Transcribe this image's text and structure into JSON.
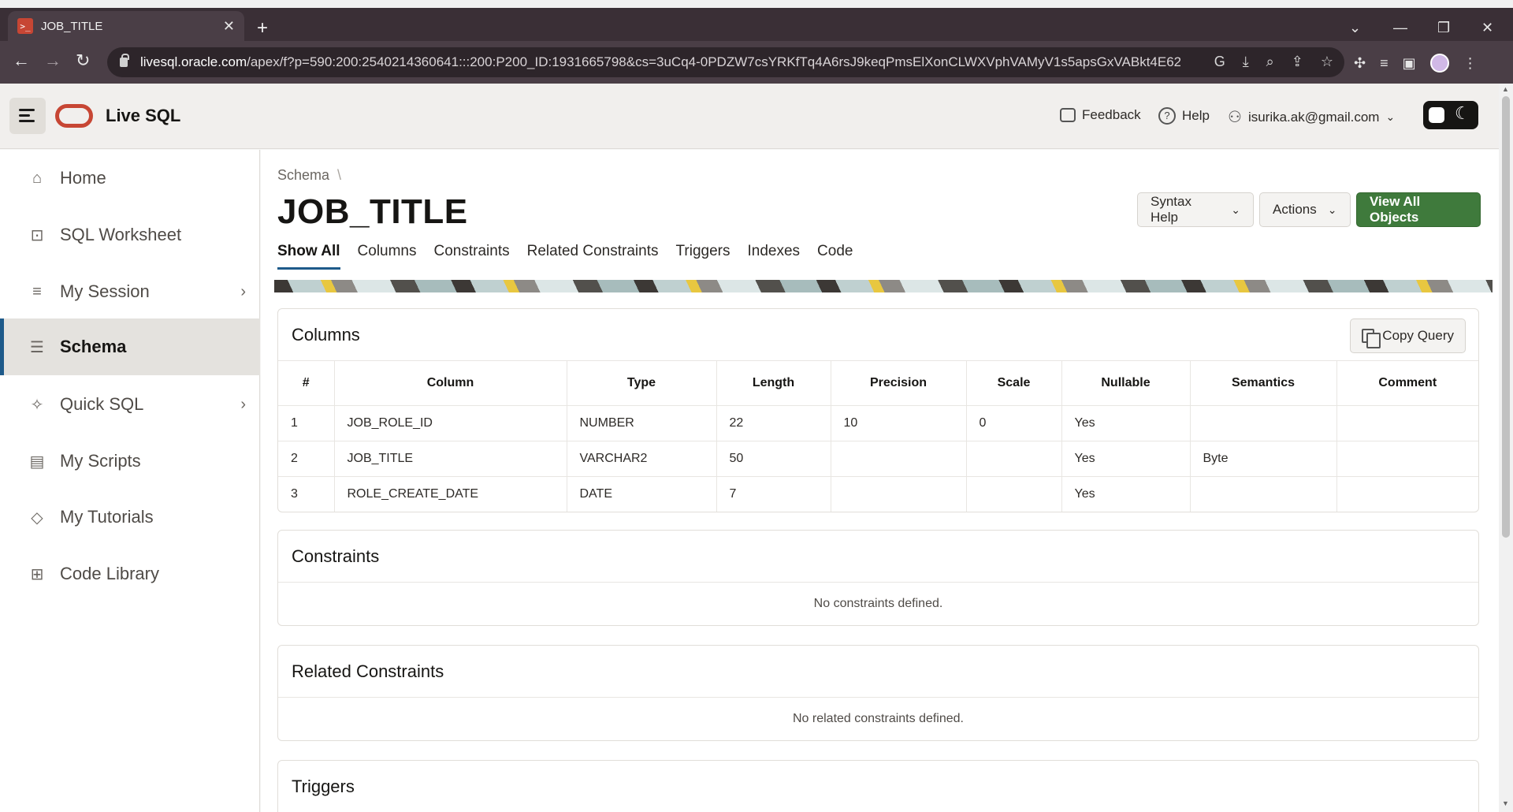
{
  "browser": {
    "tab_title": "JOB_TITLE",
    "tab_favicon": ">_",
    "url_host": "livesql.oracle.com",
    "url_path": "/apex/f?p=590:200:2540214360641:::200:P200_ID:1931665798&cs=3uCq4-0PDZW7csYRKfTq4A6rsJ9keqPmsElXonCLWXVphVAMyV1s5apsGxVABkt4E62W..."
  },
  "header": {
    "app_title": "Live SQL",
    "feedback": "Feedback",
    "help": "Help",
    "user": "isurika.ak@gmail.com"
  },
  "sidebar": {
    "items": [
      {
        "label": "Home",
        "icon": "home-icon",
        "active": false
      },
      {
        "label": "SQL Worksheet",
        "icon": "terminal-icon",
        "active": false
      },
      {
        "label": "My Session",
        "icon": "list-icon",
        "active": false
      },
      {
        "label": "Schema",
        "icon": "database-icon",
        "active": true
      },
      {
        "label": "Quick SQL",
        "icon": "wand-icon",
        "active": false
      },
      {
        "label": "My Scripts",
        "icon": "document-icon",
        "active": false
      },
      {
        "label": "My Tutorials",
        "icon": "graduation-cap-icon",
        "active": false
      },
      {
        "label": "Code Library",
        "icon": "library-icon",
        "active": false
      }
    ]
  },
  "main": {
    "breadcrumb": "Schema",
    "title": "JOB_TITLE",
    "buttons": {
      "syntax_help": "Syntax Help",
      "actions": "Actions",
      "view_all": "View All Objects"
    },
    "tabs": [
      "Show All",
      "Columns",
      "Constraints",
      "Related Constraints",
      "Triggers",
      "Indexes",
      "Code"
    ],
    "active_tab": "Show All",
    "columns_section": {
      "title": "Columns",
      "copy_query": "Copy Query",
      "headers": [
        "#",
        "Column",
        "Type",
        "Length",
        "Precision",
        "Scale",
        "Nullable",
        "Semantics",
        "Comment"
      ],
      "rows": [
        [
          "1",
          "JOB_ROLE_ID",
          "NUMBER",
          "22",
          "10",
          "0",
          "Yes",
          "",
          ""
        ],
        [
          "2",
          "JOB_TITLE",
          "VARCHAR2",
          "50",
          "",
          "",
          "Yes",
          "Byte",
          ""
        ],
        [
          "3",
          "ROLE_CREATE_DATE",
          "DATE",
          "7",
          "",
          "",
          "Yes",
          "",
          ""
        ]
      ]
    },
    "constraints_section": {
      "title": "Constraints",
      "empty": "No constraints defined."
    },
    "related_constraints_section": {
      "title": "Related Constraints",
      "empty": "No related constraints defined."
    },
    "triggers_section": {
      "title": "Triggers"
    }
  },
  "colors": {
    "oracle_red": "#c74634",
    "primary_green": "#3f7a3c",
    "active_accent": "#1e5a8a"
  }
}
